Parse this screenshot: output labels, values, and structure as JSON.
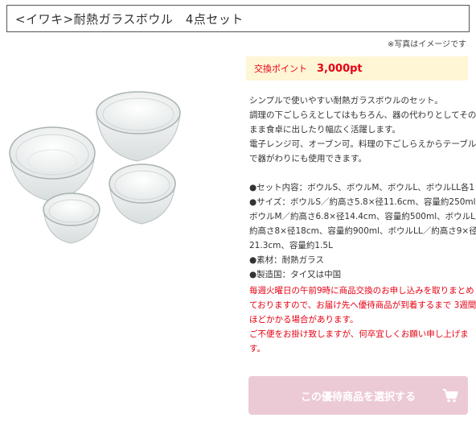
{
  "product": {
    "title": "<イワキ>耐熱ガラスボウル　4点セット",
    "photo_note": "※写真はイメージです",
    "image_alt": "耐熱ガラスボウル4点セット"
  },
  "points": {
    "label": "交換ポイント",
    "value": "3,000pt"
  },
  "description": {
    "lines": [
      "シンプルで使いやすい耐熱ガラスボウルのセット。",
      "調理の下ごしらえとしてはもちろん、器の代わりとしてその",
      "まま食卓に出したり幅広く活躍します。",
      "電子レンジ可、オーブン可。料理の下ごしらえからテーブル",
      "で器がわりにも使用できます。"
    ],
    "spec_lines": [
      "●セット内容：ボウルS、ボウルM、ボウルL、ボウルLL各1",
      "●サイズ：ボウルS／約高さ5.8×径11.6cm、容量約250ml、",
      "ボウルM／約高さ6.8×径14.4cm、容量約500ml、ボウルL／",
      "約高さ8×径18cm、容量約900ml、ボウルLL／約高さ9×径",
      "21.3cm、容量約1.5L",
      "●素材：耐熱ガラス",
      "●製造国：タイ又は中国"
    ]
  },
  "notice": {
    "lines": [
      "毎週火曜日の午前9時に商品交換のお申し込みを取りまとめ",
      "ておりますので、お届け先へ優待商品が到着するまで 3週間",
      "ほどかかる場合があります。",
      "ご不便をお掛け致しますが、何卒宜しくお願い申し上げま",
      "す。"
    ]
  },
  "button": {
    "label": "この優待商品を選択する",
    "icon": "cart-icon"
  },
  "colors": {
    "accent_red": "#e60012",
    "points_bg": "#fff6d6",
    "button_bg": "#eccad5"
  }
}
